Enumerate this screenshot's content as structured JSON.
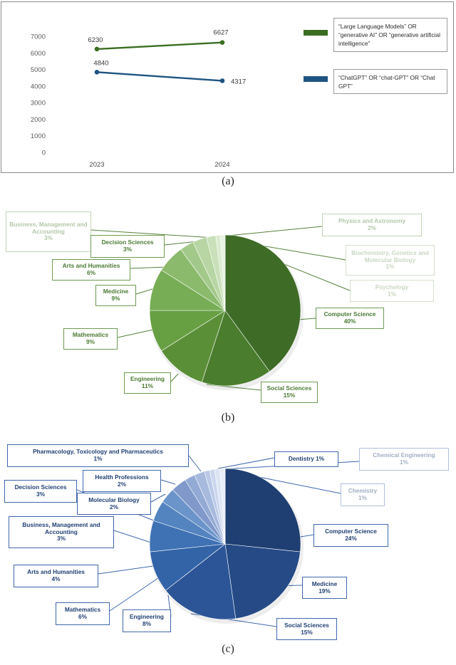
{
  "figure": {
    "captions": {
      "a": "(a)",
      "b": "(b)",
      "c": "(c)"
    }
  },
  "panel_a": {
    "legend": [
      {
        "name": "llm-series",
        "color": "#3b6e22",
        "text": "“Large Language Models”  OR “generative AI” OR  “generative artificial intelligence”"
      },
      {
        "name": "chatgpt-series",
        "color": "#1f5482",
        "text": "“ChatGPT” OR “chat-GPT”  OR “Chat GPT”"
      }
    ],
    "chart_data": {
      "type": "line",
      "title": "",
      "xlabel": "",
      "ylabel": "",
      "x": [
        "2023",
        "2024"
      ],
      "categories": [
        "2023",
        "2024"
      ],
      "yticks": [
        "0",
        "1000",
        "2000",
        "3000",
        "4000",
        "5000",
        "6000",
        "7000"
      ],
      "ylim": [
        0,
        7000
      ],
      "grid": false,
      "legend_position": "right",
      "series": [
        {
          "name": "“Large Language Models”  OR “generative AI” OR  “generative artificial intelligence”",
          "color": "#3b6e22",
          "values": [
            6230,
            6627
          ],
          "labels": [
            "6230",
            "6627"
          ]
        },
        {
          "name": "“ChatGPT” OR “chat-GPT”  OR “Chat GPT”",
          "color": "#1f5482",
          "values": [
            4840,
            4317
          ],
          "labels": [
            "4840",
            "4317"
          ]
        }
      ]
    }
  },
  "panel_b": {
    "chart_data": {
      "type": "pie",
      "title": "",
      "accent": "#4a7a32",
      "legend_position": "callout-labels",
      "categories": [
        "Computer Science",
        "Social Sciences",
        "Engineering",
        "Mathematics",
        "Medicine",
        "Arts and Humanities",
        "Decision Sciences",
        "Business, Management and Accounting",
        "Physics and Astronomy",
        "Biochemistry, Genetics and Molecular Biology",
        "Psychology"
      ],
      "values": [
        40,
        15,
        11,
        9,
        9,
        6,
        3,
        3,
        2,
        1,
        1
      ],
      "labels": [
        {
          "name": "Computer Science",
          "pct": "40%"
        },
        {
          "name": "Social Sciences",
          "pct": "15%"
        },
        {
          "name": "Engineering",
          "pct": "11%"
        },
        {
          "name": "Mathematics",
          "pct": "9%"
        },
        {
          "name": "Medicine",
          "pct": "9%"
        },
        {
          "name": "Arts and Humanities",
          "pct": "6%"
        },
        {
          "name": "Decision Sciences",
          "pct": "3%"
        },
        {
          "name": "Business, Management and Accounting",
          "pct": "3%"
        },
        {
          "name": "Physics and Astronomy",
          "pct": "2%"
        },
        {
          "name": "Biochemistry, Genetics and Molecular Biology",
          "pct": "1%"
        },
        {
          "name": "Psychology",
          "pct": "1%"
        }
      ]
    }
  },
  "panel_c": {
    "chart_data": {
      "type": "pie",
      "title": "",
      "accent": "#1f3f73",
      "legend_position": "callout-labels",
      "categories": [
        "Computer Science",
        "Medicine",
        "Social Sciences",
        "Engineering",
        "Mathematics",
        "Arts and Humanities",
        "Business, Management and Accounting",
        "Decision Sciences",
        "Molecular Biology",
        "Health Professions",
        "Pharmacology, Toxicology and Pharmaceutics",
        "Dentistry",
        "Chemical Engineering",
        "Chemistry"
      ],
      "values": [
        24,
        19,
        15,
        8,
        6,
        4,
        3,
        3,
        2,
        2,
        1,
        1,
        1,
        1
      ],
      "labels": [
        {
          "name": "Computer Science",
          "pct": "24%"
        },
        {
          "name": "Medicine",
          "pct": "19%"
        },
        {
          "name": "Social Sciences",
          "pct": "15%"
        },
        {
          "name": "Engineering",
          "pct": "8%"
        },
        {
          "name": "Mathematics",
          "pct": "6%"
        },
        {
          "name": "Arts and Humanities",
          "pct": "4%"
        },
        {
          "name": "Business, Management and Accounting",
          "pct": "3%"
        },
        {
          "name": "Decision Sciences",
          "pct": "3%"
        },
        {
          "name": "Molecular Biology",
          "pct": "2%"
        },
        {
          "name": "Health Professions",
          "pct": "2%"
        },
        {
          "name": "Pharmacology, Toxicology and Pharmaceutics",
          "pct": "1%"
        },
        {
          "name": "Dentistry 1%",
          "pct": ""
        },
        {
          "name": "Chemical Engineering",
          "pct": "1%"
        },
        {
          "name": "Chemistry",
          "pct": "1%"
        }
      ]
    }
  }
}
